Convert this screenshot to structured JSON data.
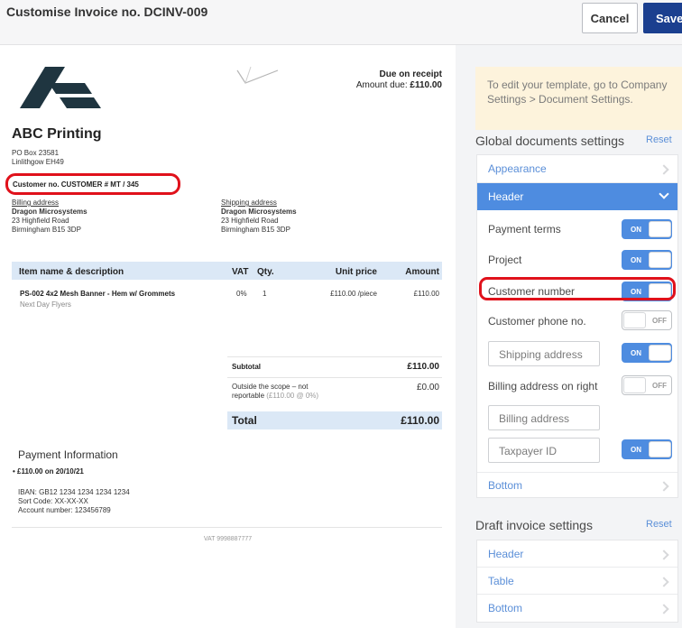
{
  "topbar": {
    "title": "Customise Invoice no. DCINV-009",
    "cancel_label": "Cancel",
    "save_label": "Save"
  },
  "invoice": {
    "due_title": "Due on receipt",
    "amount_due_label": "Amount due:",
    "amount_due_value": "£110.00",
    "company": {
      "name": "ABC Printing",
      "address": [
        "PO Box 23581",
        "Linlithgow EH49"
      ]
    },
    "customer_number": "Customer no. CUSTOMER # MT / 345",
    "billing": {
      "heading": "Billing address",
      "name": "Dragon Microsystems",
      "lines": [
        "23 Highfield Road",
        "Birmingham B15 3DP"
      ]
    },
    "shipping": {
      "heading": "Shipping address",
      "name": "Dragon Microsystems",
      "lines": [
        "23 Highfield Road",
        "Birmingham B15 3DP"
      ]
    },
    "columns": [
      "Item name & description",
      "VAT",
      "Qty.",
      "Unit price",
      "Amount"
    ],
    "item": {
      "name": "PS-002 4x2 Mesh Banner - Hem w/ Grommets",
      "description": "Next Day Flyers",
      "vat": "0%",
      "qty": "1",
      "unit_price": "£110.00 /piece",
      "amount": "£110.00"
    },
    "subtotal_label": "Subtotal",
    "subtotal_value": "£110.00",
    "outside_scope_label_1": "Outside the scope – not",
    "outside_scope_label_2": "reportable",
    "outside_scope_detail": "(£110.00 @ 0%)",
    "outside_scope_value": "£0.00",
    "total_label": "Total",
    "total_value": "£110.00",
    "payment_title": "Payment Information",
    "payment_bullet": "• £110.00 on 20/10/21",
    "bank_lines": [
      "IBAN: GB12 1234 1234 1234 1234",
      "Sort Code: XX-XX-XX",
      "Account number: 123456789"
    ],
    "vat_footer": "VAT 9998887777"
  },
  "panel": {
    "notice": "To edit your template, go to Company Settings > Document Settings.",
    "global_title": "Global documents settings",
    "reset_label": "Reset",
    "global_rows": {
      "appearance": "Appearance",
      "header": "Header",
      "bottom": "Bottom"
    },
    "settings": [
      {
        "label": "Payment terms",
        "state": "ON"
      },
      {
        "label": "Project",
        "state": "ON"
      },
      {
        "label": "Customer number",
        "state": "ON"
      },
      {
        "label": "Customer phone no.",
        "state": "OFF"
      },
      {
        "label": "Shipping address",
        "state": "ON"
      },
      {
        "label": "Billing address on right",
        "state": "OFF"
      },
      {
        "label": "Billing address"
      },
      {
        "label": "Taxpayer ID",
        "state": "ON"
      }
    ],
    "draft_title": "Draft invoice settings",
    "draft_rows": [
      "Header",
      "Table",
      "Bottom"
    ]
  },
  "colors": {
    "primary": "#1b3f8f",
    "accent": "#4e8ce0",
    "link": "#5b8fd8",
    "highlight": "#e0111b",
    "notice_bg": "#fdf3dc",
    "table_head_bg": "#dbe8f6"
  }
}
